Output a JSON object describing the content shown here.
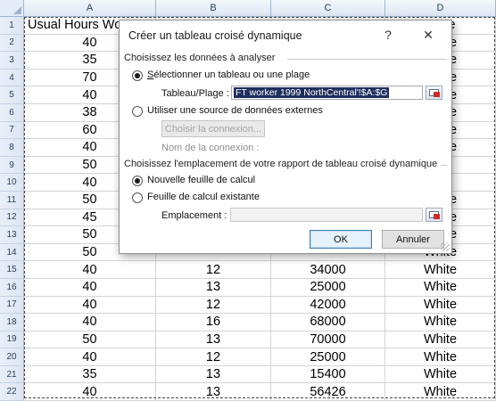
{
  "sheet": {
    "columns": [
      "A",
      "B",
      "C",
      "D"
    ],
    "header_cell": "Usual Hours Wo",
    "header_cell_d": "Race",
    "rows": [
      {
        "n": "1",
        "a": "",
        "b": "",
        "c": "",
        "d": ""
      },
      {
        "n": "2",
        "a": "40",
        "b": "",
        "c": "",
        "d": "White"
      },
      {
        "n": "3",
        "a": "35",
        "b": "",
        "c": "",
        "d": "White"
      },
      {
        "n": "4",
        "a": "70",
        "b": "",
        "c": "",
        "d": "White"
      },
      {
        "n": "5",
        "a": "40",
        "b": "",
        "c": "",
        "d": "White"
      },
      {
        "n": "6",
        "a": "38",
        "b": "",
        "c": "",
        "d": "White"
      },
      {
        "n": "7",
        "a": "60",
        "b": "",
        "c": "",
        "d": "White"
      },
      {
        "n": "8",
        "a": "40",
        "b": "",
        "c": "",
        "d": "White"
      },
      {
        "n": "9",
        "a": "50",
        "b": "",
        "c": "",
        "d": "ck"
      },
      {
        "n": "10",
        "a": "40",
        "b": "",
        "c": "",
        "d": "ck"
      },
      {
        "n": "11",
        "a": "50",
        "b": "",
        "c": "",
        "d": "White"
      },
      {
        "n": "12",
        "a": "45",
        "b": "",
        "c": "",
        "d": "White"
      },
      {
        "n": "13",
        "a": "50",
        "b": "",
        "c": "",
        "d": "White"
      },
      {
        "n": "14",
        "a": "50",
        "b": "",
        "c": "",
        "d": "White"
      },
      {
        "n": "15",
        "a": "40",
        "b": "12",
        "c": "34000",
        "d": "White"
      },
      {
        "n": "16",
        "a": "40",
        "b": "13",
        "c": "25000",
        "d": "White"
      },
      {
        "n": "17",
        "a": "40",
        "b": "12",
        "c": "42000",
        "d": "White"
      },
      {
        "n": "18",
        "a": "40",
        "b": "16",
        "c": "68000",
        "d": "White"
      },
      {
        "n": "19",
        "a": "50",
        "b": "13",
        "c": "70000",
        "d": "White"
      },
      {
        "n": "20",
        "a": "40",
        "b": "12",
        "c": "25000",
        "d": "White"
      },
      {
        "n": "21",
        "a": "35",
        "b": "13",
        "c": "15400",
        "d": "White"
      },
      {
        "n": "22",
        "a": "40",
        "b": "13",
        "c": "56426",
        "d": "White"
      }
    ]
  },
  "dialog": {
    "title": "Créer un tableau croisé dynamique",
    "help": "?",
    "close": "✕",
    "section1": "Choisissez les données à analyser",
    "radio_table": "Sélectionner un tableau ou une plage",
    "range_label": "Tableau/Plage :",
    "range_value": "FT worker 1999 NorthCentral'!$A:$G",
    "radio_external": "Utiliser une source de données externes",
    "choose_connection": "Choisir la connexion...",
    "connection_name": "Nom de la connexion :",
    "section2": "Choisissez l'emplacement de votre rapport de tableau croisé dynamique",
    "radio_new": "Nouvelle feuille de calcul",
    "radio_existing": "Feuille de calcul existante",
    "location_label": "Emplacement :",
    "location_value": "",
    "ok": "OK",
    "cancel": "Annuler",
    "selected_source": "table",
    "selected_destination": "new"
  }
}
